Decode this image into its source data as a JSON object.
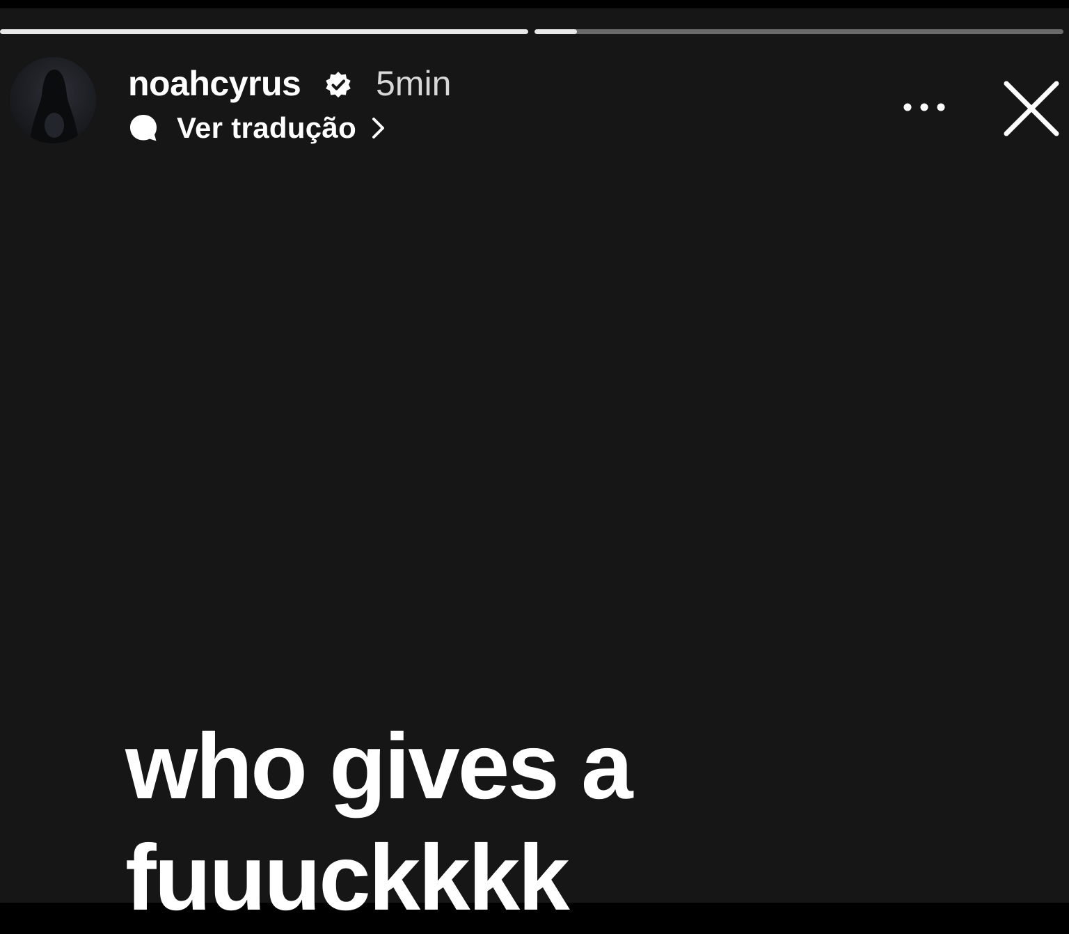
{
  "story": {
    "progress_segments": [
      {
        "progress": 1.0
      },
      {
        "progress": 0.08
      }
    ],
    "header": {
      "username": "noahcyrus",
      "verified": true,
      "timestamp": "5min",
      "translate_label": "Ver tradução",
      "more_icon": "more-horizontal-icon",
      "close_icon": "close-icon"
    },
    "text_lines": [
      "who gives a",
      "fuuuckkkk"
    ]
  },
  "colors": {
    "background": "#161616",
    "top_bar": "#000000",
    "text": "#ffffff",
    "progress_track": "#6a6a6a",
    "progress_fill": "#e8e8e8"
  }
}
